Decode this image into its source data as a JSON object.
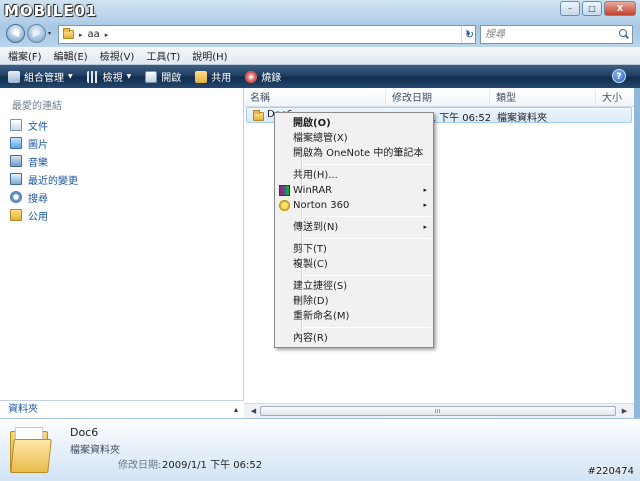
{
  "window": {
    "logo_text": "MOBILE01",
    "controls": {
      "minimize": "–",
      "maximize": "□",
      "close": "X"
    }
  },
  "address_bar": {
    "path": [
      "aa"
    ],
    "arrow": "▸",
    "dropdown": "▾",
    "refresh": "↻"
  },
  "search": {
    "placeholder": "搜尋"
  },
  "menu": [
    "檔案(F)",
    "編輯(E)",
    "檢視(V)",
    "工具(T)",
    "說明(H)"
  ],
  "command_bar": {
    "items": [
      {
        "label": "組合管理",
        "icon": "organize-icon",
        "dropdown": true
      },
      {
        "label": "檢視",
        "icon": "views-icon",
        "dropdown": true
      },
      {
        "label": "開啟",
        "icon": "open-icon",
        "dropdown": false
      },
      {
        "label": "共用",
        "icon": "share-icon",
        "dropdown": false
      },
      {
        "label": "燒錄",
        "icon": "burn-icon",
        "dropdown": false
      }
    ],
    "help": "?"
  },
  "nav_pane": {
    "favorites_title": "最愛的連結",
    "favorites": [
      {
        "label": "文件",
        "icon": "documents-icon"
      },
      {
        "label": "圖片",
        "icon": "pictures-icon"
      },
      {
        "label": "音樂",
        "icon": "music-icon"
      },
      {
        "label": "最近的變更",
        "icon": "recent-icon"
      },
      {
        "label": "搜尋",
        "icon": "search-icon"
      },
      {
        "label": "公用",
        "icon": "public-folder-icon"
      }
    ],
    "folders_label": "資料夾",
    "folders_caret": "▴"
  },
  "file_list": {
    "columns": [
      "名稱",
      "修改日期",
      "類型",
      "大小"
    ],
    "rows": [
      {
        "name": "Doc6",
        "modified": "2009/1/1 下午 06:52",
        "type": "檔案資料夾",
        "size": ""
      }
    ]
  },
  "context_menu": {
    "items": [
      {
        "label": "開啟(O)",
        "bold": true
      },
      {
        "label": "檔案總管(X)"
      },
      {
        "label": "開啟為 OneNote 中的筆記本"
      },
      {
        "label": "共用(H)..."
      },
      {
        "label": "WinRAR",
        "submenu": true,
        "icon": "winrar-icon"
      },
      {
        "label": "Norton 360",
        "submenu": true,
        "icon": "norton-icon"
      },
      {
        "label": "傳送到(N)",
        "submenu": true
      },
      {
        "label": "剪下(T)"
      },
      {
        "label": "複製(C)"
      },
      {
        "label": "建立捷徑(S)"
      },
      {
        "label": "刪除(D)"
      },
      {
        "label": "重新命名(M)"
      },
      {
        "label": "內容(R)"
      }
    ],
    "submenu_arrow": "▸"
  },
  "details": {
    "name": "Doc6",
    "type": "檔案資料夾",
    "modified_label": "修改日期:",
    "modified_value": "2009/1/1 下午 06:52"
  },
  "watermark": "#220474",
  "colors": {
    "link_blue": "#1c57a5",
    "command_bar": "#1d3b5e",
    "selection": "#d9ebfa"
  }
}
